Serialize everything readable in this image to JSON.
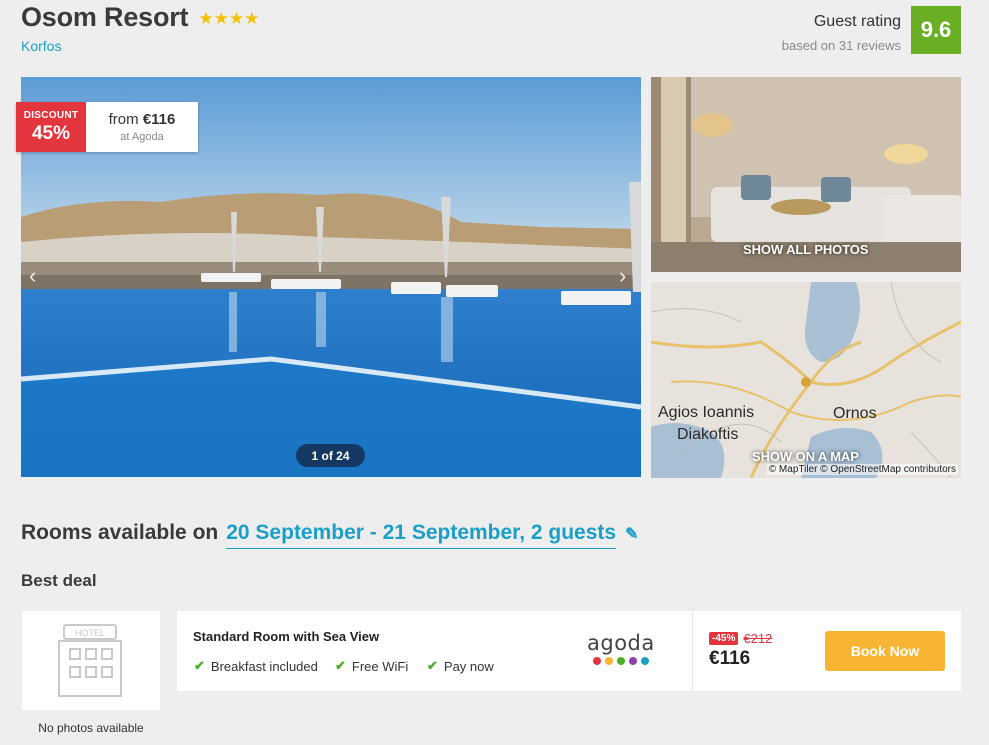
{
  "hotel": {
    "name": "Osom Resort",
    "stars": "★★★★",
    "location": "Korfos"
  },
  "rating": {
    "label": "Guest rating",
    "reviews": "based on 31 reviews",
    "score": "9.6"
  },
  "deal_badge": {
    "label": "DISCOUNT",
    "percent": "45%",
    "from_prefix": "from",
    "price": "€116",
    "provider": "at Agoda"
  },
  "gallery": {
    "counter": "1 of 24",
    "show_all": "SHOW ALL PHOTOS",
    "show_map": "SHOW ON A MAP",
    "map_credit": "© MapTiler © OpenStreetMap contributors",
    "map_towns": [
      "Agios Ioannis",
      "Diakoftis",
      "Ornos"
    ]
  },
  "rooms": {
    "heading": "Rooms available on",
    "dates": "20 September - 21 September, 2 guests",
    "best_deal": "Best deal"
  },
  "offer": {
    "no_photo_text": "No photos available",
    "hotel_sign": "HOTEL",
    "room_name": "Standard Room with Sea View",
    "amenities": [
      "Breakfast included",
      "Free WiFi",
      "Pay now"
    ],
    "provider_logo": "agoda",
    "discount_badge": "-45%",
    "old_price": "€212",
    "price": "€116",
    "book_label": "Book Now"
  },
  "colors": {
    "accent": "#1a9fc9",
    "rating": "#6aae24",
    "discount": "#e2353e",
    "book": "#f7b533"
  }
}
